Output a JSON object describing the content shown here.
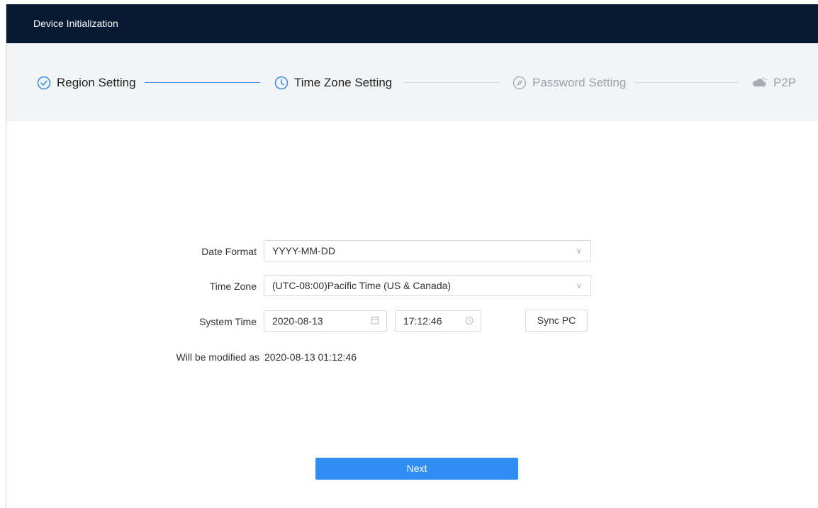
{
  "window": {
    "title": "Device Initialization"
  },
  "steps": [
    {
      "label": "Region Setting",
      "state": "done",
      "icon": "check-circle-icon"
    },
    {
      "label": "Time Zone Setting",
      "state": "active",
      "icon": "clock-icon"
    },
    {
      "label": "Password Setting",
      "state": "pending",
      "icon": "compass-icon"
    },
    {
      "label": "P2P",
      "state": "pending",
      "icon": "cloud-icon"
    }
  ],
  "form": {
    "date_format": {
      "label": "Date Format",
      "value": "YYYY-MM-DD"
    },
    "time_zone": {
      "label": "Time Zone",
      "value": "(UTC-08:00)Pacific Time (US & Canada)"
    },
    "system_time": {
      "label": "System Time",
      "date": "2020-08-13",
      "time": "17:12:46",
      "sync_label": "Sync PC"
    },
    "modified": {
      "label": "Will be modified as",
      "value": "2020-08-13 01:12:46"
    }
  },
  "actions": {
    "next_label": "Next"
  },
  "colors": {
    "titlebar": "#071a31",
    "accent": "#2f8df4",
    "steps_bg": "#f2f4f6"
  }
}
